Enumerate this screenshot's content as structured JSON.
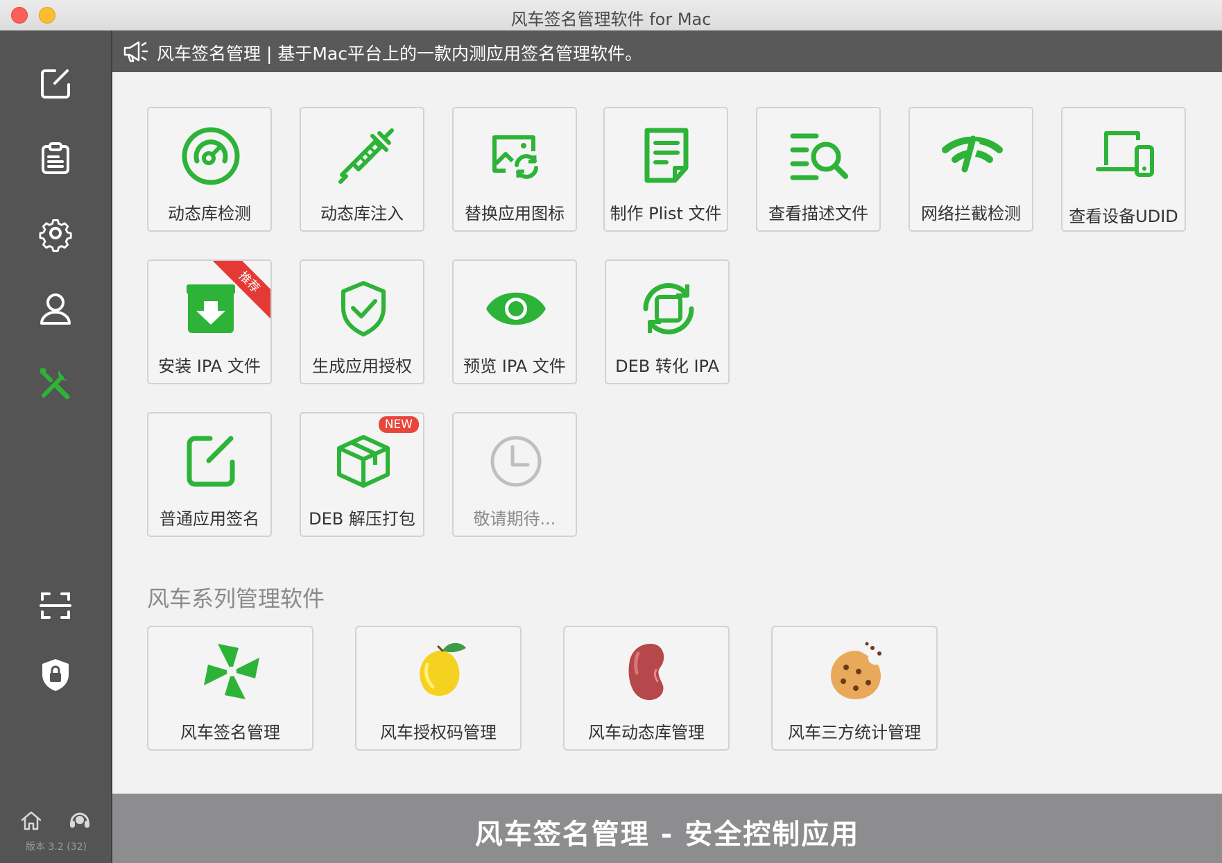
{
  "window": {
    "title": "风车签名管理软件 for Mac"
  },
  "announcement": {
    "text": "风车签名管理 | 基于Mac平台上的一款内测应用签名管理软件。"
  },
  "sidebar": {
    "items": [
      {
        "name": "edit-icon",
        "active": false
      },
      {
        "name": "clipboard-icon",
        "active": false
      },
      {
        "name": "gear-icon",
        "active": false
      },
      {
        "name": "user-icon",
        "active": false
      },
      {
        "name": "tools-icon",
        "active": true
      },
      {
        "name": "scan-icon",
        "active": false
      },
      {
        "name": "shield-lock-icon",
        "active": false
      }
    ],
    "version": "版本 3.2 (32)"
  },
  "tools": [
    {
      "label": "动态库检测",
      "icon": "gauge-icon"
    },
    {
      "label": "动态库注入",
      "icon": "syringe-icon"
    },
    {
      "label": "替换应用图标",
      "icon": "image-swap-icon"
    },
    {
      "label": "制作 Plist 文件",
      "icon": "document-icon"
    },
    {
      "label": "查看描述文件",
      "icon": "list-search-icon"
    },
    {
      "label": "网络拦截检测",
      "icon": "wifi-cut-icon"
    },
    {
      "label": "查看设备UDID",
      "icon": "devices-icon"
    },
    {
      "label": "安装 IPA 文件",
      "icon": "install-box-icon",
      "ribbon": "推荐"
    },
    {
      "label": "生成应用授权",
      "icon": "shield-check-icon"
    },
    {
      "label": "预览 IPA 文件",
      "icon": "eye-icon"
    },
    {
      "label": "DEB 转化 IPA",
      "icon": "convert-icon"
    },
    {
      "label": "普通应用签名",
      "icon": "sign-edit-icon"
    },
    {
      "label": "DEB 解压打包",
      "icon": "package-icon",
      "badge": "NEW"
    },
    {
      "label": "敬请期待...",
      "icon": "clock-icon",
      "disabled": true
    }
  ],
  "series": {
    "title": "风车系列管理软件",
    "apps": [
      {
        "label": "风车签名管理",
        "icon": "pinwheel-icon"
      },
      {
        "label": "风车授权码管理",
        "icon": "lemon-icon"
      },
      {
        "label": "风车动态库管理",
        "icon": "bean-icon"
      },
      {
        "label": "风车三方统计管理",
        "icon": "cookie-icon"
      }
    ]
  },
  "footer": {
    "slogan": "风车签名管理 - 安全控制应用"
  },
  "colors": {
    "accent": "#2db337",
    "sidebar": "#545454",
    "footer": "#8d8d8f",
    "badge": "#e53935"
  }
}
